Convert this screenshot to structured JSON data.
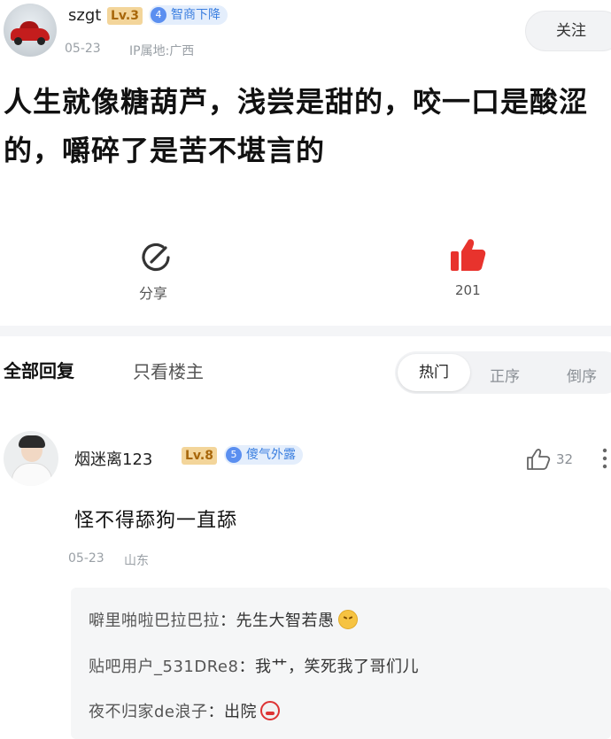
{
  "post": {
    "username": "szgt",
    "level": "Lv.3",
    "badge_num": "4",
    "badge_text": "智商下降",
    "date": "05-23",
    "ip": "IP属地:广西",
    "follow_label": "关注",
    "text": "人生就像糖葫芦，浅尝是甜的，咬一口是酸涩的，嚼碎了是苦不堪言的",
    "share_label": "分享",
    "like_count": "201"
  },
  "replies_header": {
    "all": "全部回复",
    "op_only": "只看楼主",
    "sort_hot": "热门",
    "sort_asc": "正序",
    "sort_desc": "倒序"
  },
  "comment": {
    "username": "烟迷离123",
    "level": "Lv.8",
    "badge_num": "5",
    "badge_text": "傻气外露",
    "text": "怪不得舔狗一直舔",
    "date": "05-23",
    "location": "山东",
    "like_count": "32",
    "replies": [
      {
        "name": "噼里啪啦巴拉巴拉",
        "text": "：先生大智若愚",
        "emoji": "laugh-emoji"
      },
      {
        "name": "贴吧用户_531DRe8",
        "text": "：我艹，笑死我了哥们儿",
        "emoji": ""
      },
      {
        "name": "夜不归家de浪子",
        "text": "：出院",
        "emoji": "angry-emoji"
      }
    ]
  },
  "colors": {
    "like_red": "#e8332d",
    "level_bg": "#f3d59a",
    "badge_blue": "#5b8ff0"
  }
}
